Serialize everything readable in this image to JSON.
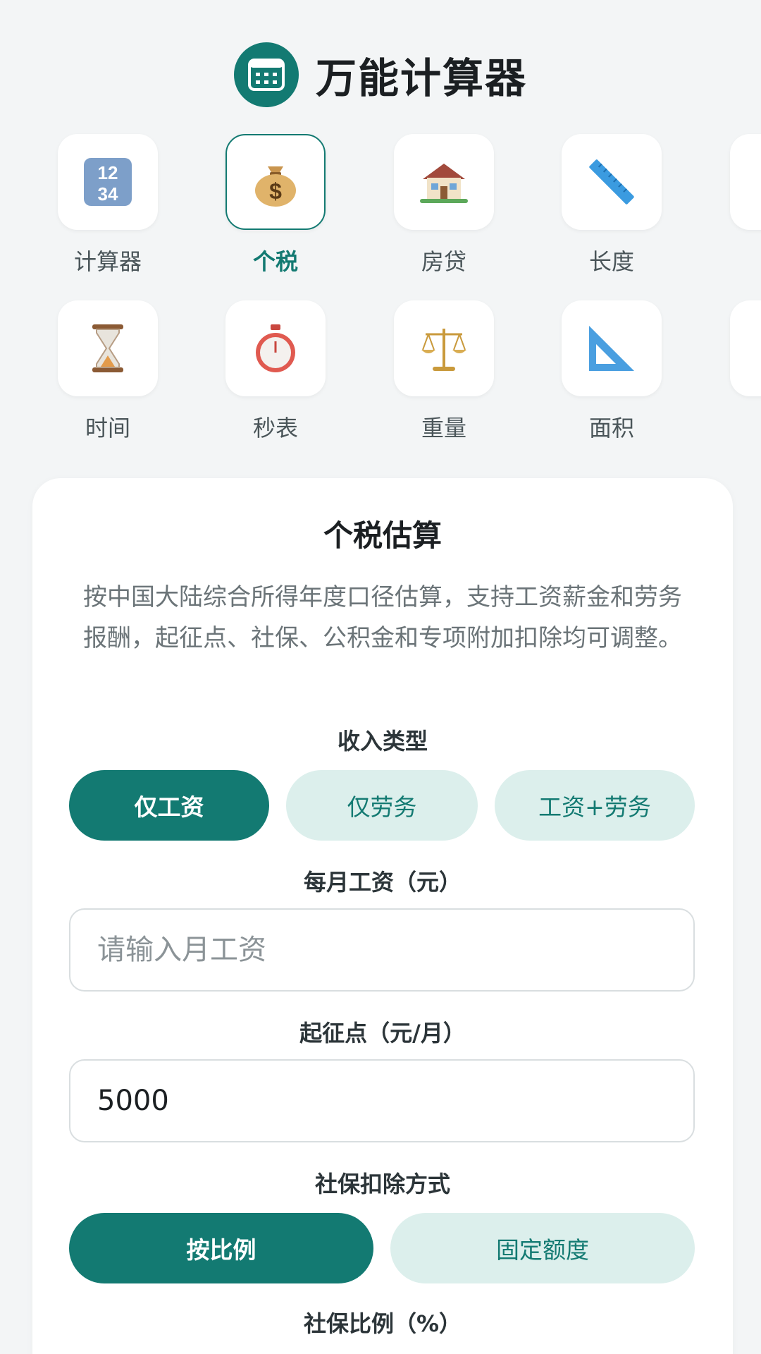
{
  "app": {
    "title": "万能计算器"
  },
  "tools": [
    {
      "label": "计算器",
      "icon": "number-pad-icon",
      "active": false
    },
    {
      "label": "个税",
      "icon": "money-bag-icon",
      "active": true
    },
    {
      "label": "房贷",
      "icon": "house-icon",
      "active": false
    },
    {
      "label": "长度",
      "icon": "ruler-icon",
      "active": false
    },
    {
      "label": "时间",
      "icon": "hourglass-icon",
      "active": false
    },
    {
      "label": "秒表",
      "icon": "stopwatch-icon",
      "active": false
    },
    {
      "label": "重量",
      "icon": "scales-icon",
      "active": false
    },
    {
      "label": "面积",
      "icon": "triangle-ruler-icon",
      "active": false
    }
  ],
  "card": {
    "title": "个税估算",
    "description": "按中国大陆综合所得年度口径估算，支持工资薪金和劳务报酬，起征点、社保、公积金和专项附加扣除均可调整。",
    "income_type": {
      "label": "收入类型",
      "options": [
        "仅工资",
        "仅劳务",
        "工资+劳务"
      ],
      "selected": "仅工资"
    },
    "monthly_salary": {
      "label": "每月工资（元）",
      "value": "",
      "placeholder": "请输入月工资"
    },
    "threshold": {
      "label": "起征点（元/月）",
      "value": "5000"
    },
    "social_insurance_mode": {
      "label": "社保扣除方式",
      "options": [
        "按比例",
        "固定额度"
      ],
      "selected": "按比例"
    },
    "social_insurance_ratio": {
      "label": "社保比例（%）"
    }
  },
  "colors": {
    "accent": "#137a72",
    "accent_light": "#dcefec",
    "background": "#f3f5f6"
  }
}
